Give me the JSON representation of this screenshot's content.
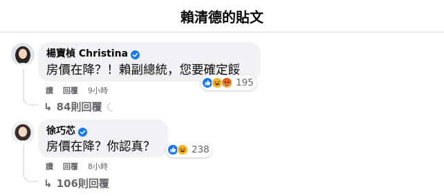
{
  "header": {
    "title": "賴清德的貼文"
  },
  "comments": [
    {
      "author": "楊寶楨 Christina",
      "verified": true,
      "text": "房價在降？！賴副總統，您要確定餒",
      "reactions": {
        "icons": [
          "like-icon",
          "haha-icon",
          "angry-icon"
        ],
        "count": "195"
      },
      "actions": {
        "like": "讚",
        "reply": "回覆",
        "time": "9小時"
      },
      "replies": {
        "arrow": "↳",
        "label": "84則回覆"
      }
    },
    {
      "author": "徐巧芯",
      "verified": true,
      "text": "房價在降？你認真？",
      "reactions": {
        "icons": [
          "like-icon",
          "haha-icon"
        ],
        "count": "238"
      },
      "actions": {
        "like": "讚",
        "reply": "回覆",
        "time": "8小時"
      },
      "replies": {
        "arrow": "↳",
        "label": "106則回覆"
      }
    }
  ],
  "colors": {
    "verified": "#1877f2",
    "like": "#1877f2",
    "haha": "#f7b125",
    "angry": "#e9710f",
    "bubble": "#f0f2f5",
    "meta": "#65676b"
  }
}
